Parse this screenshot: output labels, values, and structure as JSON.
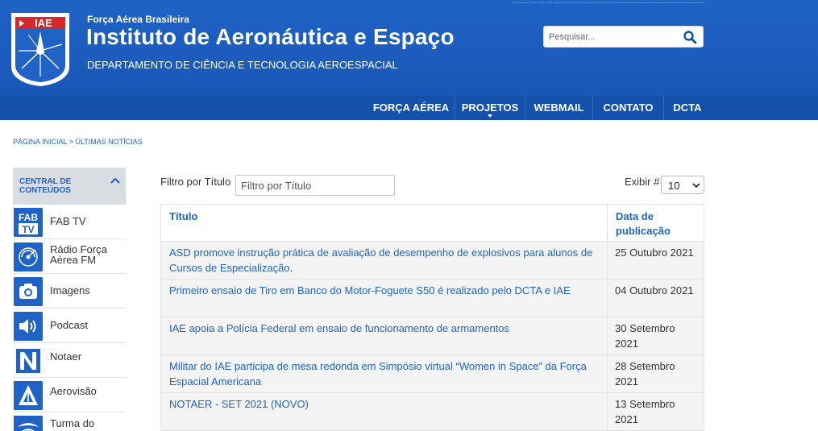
{
  "header": {
    "org": "Força Aérea Brasileira",
    "title": "Instituto de Aeronáutica e Espaço",
    "department": "DEPARTAMENTO DE CIÊNCIA E TECNOLOGIA AEROESPACIAL",
    "logo_text": "IAE",
    "search_placeholder": "Pesquisar...",
    "colors": {
      "header_blue": "#1f63c6",
      "nav_blue": "#1451ab",
      "logo_red": "#d62828"
    }
  },
  "nav": {
    "items": [
      {
        "label": "FORÇA AÉREA"
      },
      {
        "label": "PROJETOS",
        "has_dropdown": true
      },
      {
        "label": "WEBMAIL"
      },
      {
        "label": "CONTATO"
      },
      {
        "label": "DCTA"
      }
    ]
  },
  "breadcrumb": "PÁGINA INICIAL > ÚLTIMAS NOTÍCIAS",
  "sidebar": {
    "heading": "CENTRAL DE CONTEÚDOS",
    "items": [
      {
        "label": "FAB TV",
        "icon": "fab-tv-icon"
      },
      {
        "label": "Rádio Força Aérea FM",
        "icon": "radio-icon"
      },
      {
        "label": "Imagens",
        "icon": "camera-icon"
      },
      {
        "label": "Podcast",
        "icon": "speaker-icon"
      },
      {
        "label": "Notaer",
        "icon": "notaer-icon"
      },
      {
        "label": "Aerovisão",
        "icon": "aerovisao-icon"
      },
      {
        "label": "Turma do",
        "icon": "turma-icon"
      }
    ]
  },
  "filters": {
    "title_label": "Filtro por Título",
    "title_placeholder": "Filtro por Título",
    "show_label": "Exibir #",
    "show_value": "10"
  },
  "table": {
    "headers": {
      "title": "Título",
      "date": "Data de publicação"
    },
    "rows": [
      {
        "title": "ASD promove instrução prática de avaliação de desempenho de explosivos para alunos de Cursos de Especialização.",
        "date": "25 Outubro 2021"
      },
      {
        "title": "Primeiro ensaio de Tiro em Banco do Motor-Foguete S50 é realizado pelo DCTA e IAE",
        "date": "04 Outubro 2021"
      },
      {
        "title": "IAE apoia a Polícia Federal em ensaio de funcionamento de armamentos",
        "date": "30 Setembro 2021"
      },
      {
        "title": "Militar do IAE participa de mesa redonda em Simpósio virtual “Women in Space” da Força Espacial Americana",
        "date": "28 Setembro 2021"
      },
      {
        "title": "NOTAER - SET 2021 (NOVO)",
        "date": "13 Setembro 2021"
      }
    ]
  }
}
